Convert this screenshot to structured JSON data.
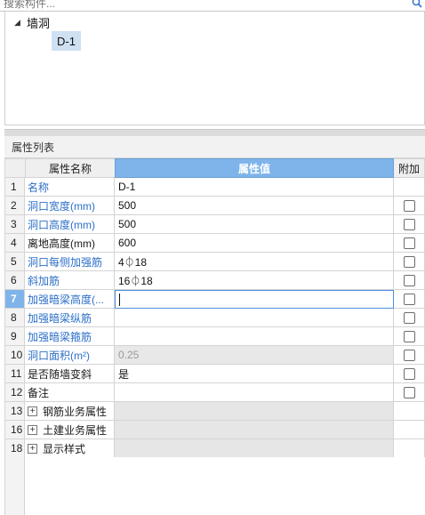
{
  "search": {
    "placeholder": "搜索构件..."
  },
  "tree": {
    "root_toggle": "◢",
    "root_label": "墙洞",
    "child_label": "D-1"
  },
  "panel": {
    "title": "属性列表"
  },
  "table": {
    "headers": {
      "name": "属性名称",
      "value": "属性值",
      "extra": "附加"
    },
    "rows": [
      {
        "num": "1",
        "name": "名称",
        "value": "D-1",
        "name_color": "blue",
        "checkbox": false
      },
      {
        "num": "2",
        "name": "洞口宽度(mm)",
        "value": "500",
        "name_color": "blue",
        "checkbox": true
      },
      {
        "num": "3",
        "name": "洞口高度(mm)",
        "value": "500",
        "name_color": "blue",
        "checkbox": true
      },
      {
        "num": "4",
        "name": "离地高度(mm)",
        "value": "600",
        "name_color": "dark",
        "checkbox": true
      },
      {
        "num": "5",
        "name": "洞口每侧加强筋",
        "value": "4⏀18",
        "name_color": "blue",
        "checkbox": true
      },
      {
        "num": "6",
        "name": "斜加筋",
        "value": "16⏀18",
        "name_color": "blue",
        "checkbox": true
      },
      {
        "num": "7",
        "name": "加强暗梁高度(...",
        "value": "",
        "name_color": "blue",
        "checkbox": true,
        "selected": true
      },
      {
        "num": "8",
        "name": "加强暗梁纵筋",
        "value": "",
        "name_color": "blue",
        "checkbox": true
      },
      {
        "num": "9",
        "name": "加强暗梁箍筋",
        "value": "",
        "name_color": "blue",
        "checkbox": true
      },
      {
        "num": "10",
        "name": "洞口面积(m²)",
        "value": "0.25",
        "name_color": "blue",
        "checkbox": true,
        "readonly": true
      },
      {
        "num": "11",
        "name": "是否随墙变斜",
        "value": "是",
        "name_color": "dark",
        "checkbox": true
      },
      {
        "num": "12",
        "name": "备注",
        "value": "",
        "name_color": "dark",
        "checkbox": true
      },
      {
        "num": "13",
        "name": "钢筋业务属性",
        "value": "",
        "name_color": "dark",
        "group": true
      },
      {
        "num": "16",
        "name": "土建业务属性",
        "value": "",
        "name_color": "dark",
        "group": true
      },
      {
        "num": "18",
        "name": "显示样式",
        "value": "",
        "name_color": "dark",
        "group": true
      }
    ],
    "expander_symbol": "+"
  },
  "colors": {
    "accent": "#7fb4ea",
    "blue_text": "#2c6fc7"
  }
}
